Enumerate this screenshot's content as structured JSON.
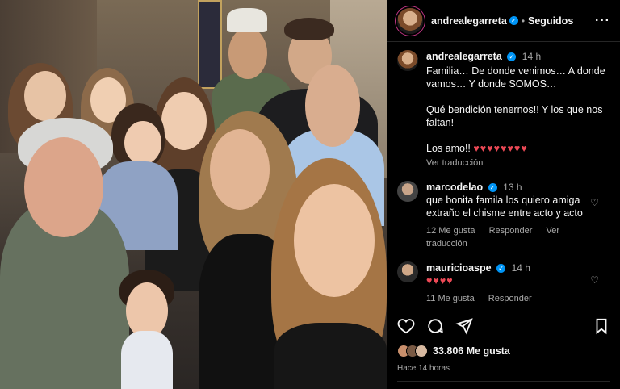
{
  "post": {
    "author": "andrealegarreta",
    "follow_status": "Seguidos",
    "more_icon": "more-options-icon"
  },
  "caption": {
    "username": "andrealegarreta",
    "time": "14 h",
    "lines": [
      "Familia… De donde venimos… A donde vamos… Y donde SOMOS…",
      "Qué bendición tenernos!! Y los que nos faltan!",
      "Los amo!!"
    ],
    "hearts": "♥♥♥♥♥♥♥♥",
    "translate": "Ver traducción"
  },
  "comments": [
    {
      "username": "marcodelao",
      "time": "13 h",
      "text": "que bonita famila los quiero amiga extraño el chisme entre acto y acto",
      "likes": "12 Me gusta",
      "reply": "Responder",
      "translate": "Ver traducción"
    },
    {
      "username": "mauricioaspe",
      "time": "14 h",
      "text": "♥♥♥♥",
      "likes": "11 Me gusta",
      "reply": "Responder"
    }
  ],
  "actions": {
    "likes_count": "33.806 Me gusta",
    "posted_ago": "Hace 14 horas"
  },
  "colors": {
    "background": "#000000",
    "text": "#f5f5f5",
    "muted": "#a8a8a8",
    "verified": "#0095f6",
    "heart": "#ed4956",
    "divider": "#262626"
  }
}
